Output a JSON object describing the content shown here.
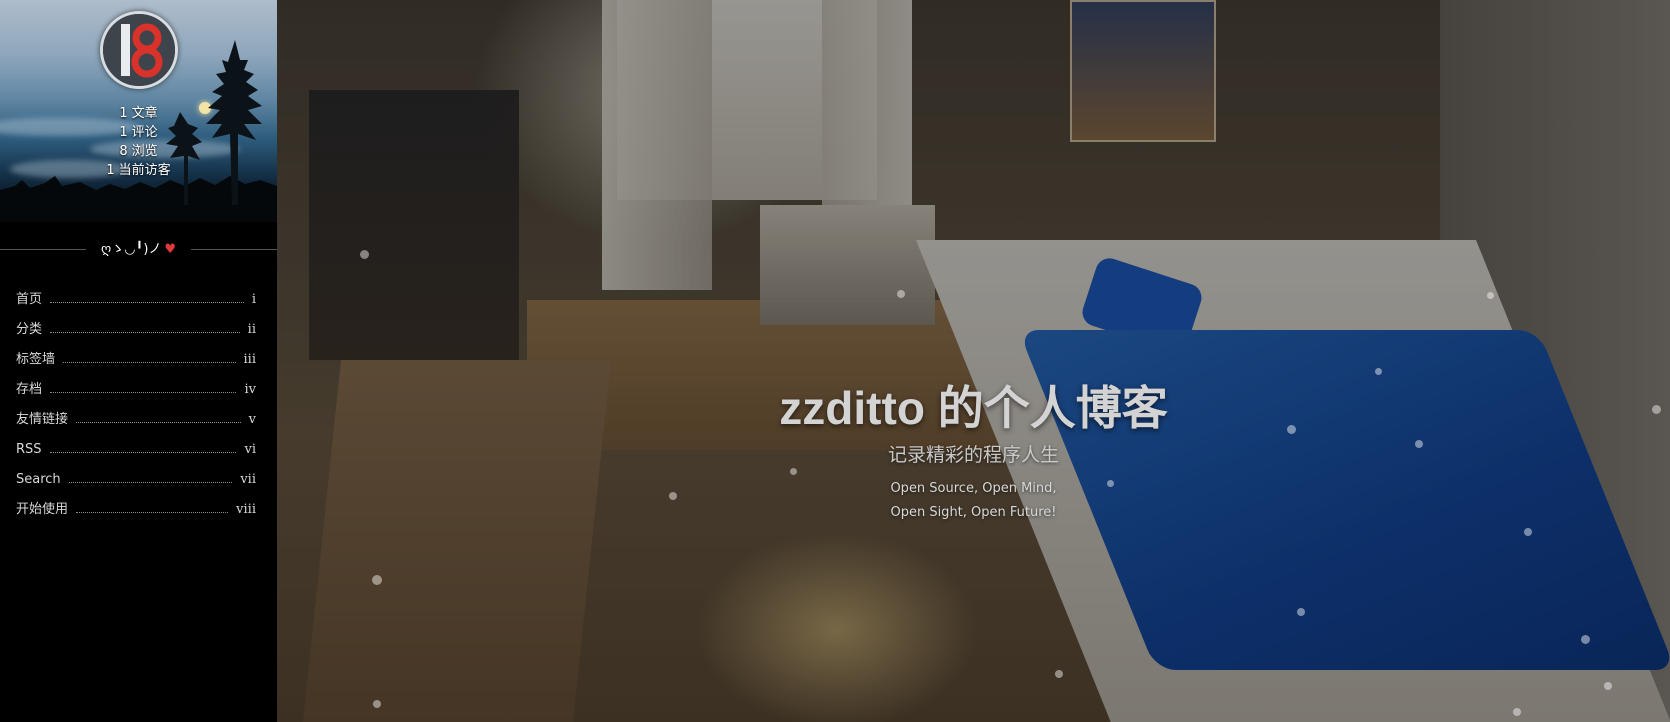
{
  "sidebar": {
    "stats": [
      {
        "count": "1",
        "label": "文章"
      },
      {
        "count": "1",
        "label": "评论"
      },
      {
        "count": "8",
        "label": "浏览"
      },
      {
        "count": "1",
        "label": "当前访客"
      }
    ],
    "divider_text": "ღゝ◡╹)ノ",
    "menu": [
      {
        "label": "首页",
        "num": "i"
      },
      {
        "label": "分类",
        "num": "ii"
      },
      {
        "label": "标签墙",
        "num": "iii"
      },
      {
        "label": "存档",
        "num": "iv"
      },
      {
        "label": "友情链接",
        "num": "v"
      },
      {
        "label": "RSS",
        "num": "vi"
      },
      {
        "label": "Search",
        "num": "vii"
      },
      {
        "label": "开始使用",
        "num": "viii"
      }
    ]
  },
  "hero": {
    "title": "zzditto 的个人博客",
    "subtitle": "记录精彩的程序人生",
    "motto_line1": "Open Source, Open Mind,",
    "motto_line2": "Open Sight, Open Future!"
  },
  "colors": {
    "sidebar_bg": "#000000",
    "heart": "#e03a3a",
    "avatar_red": "#d8322b"
  }
}
